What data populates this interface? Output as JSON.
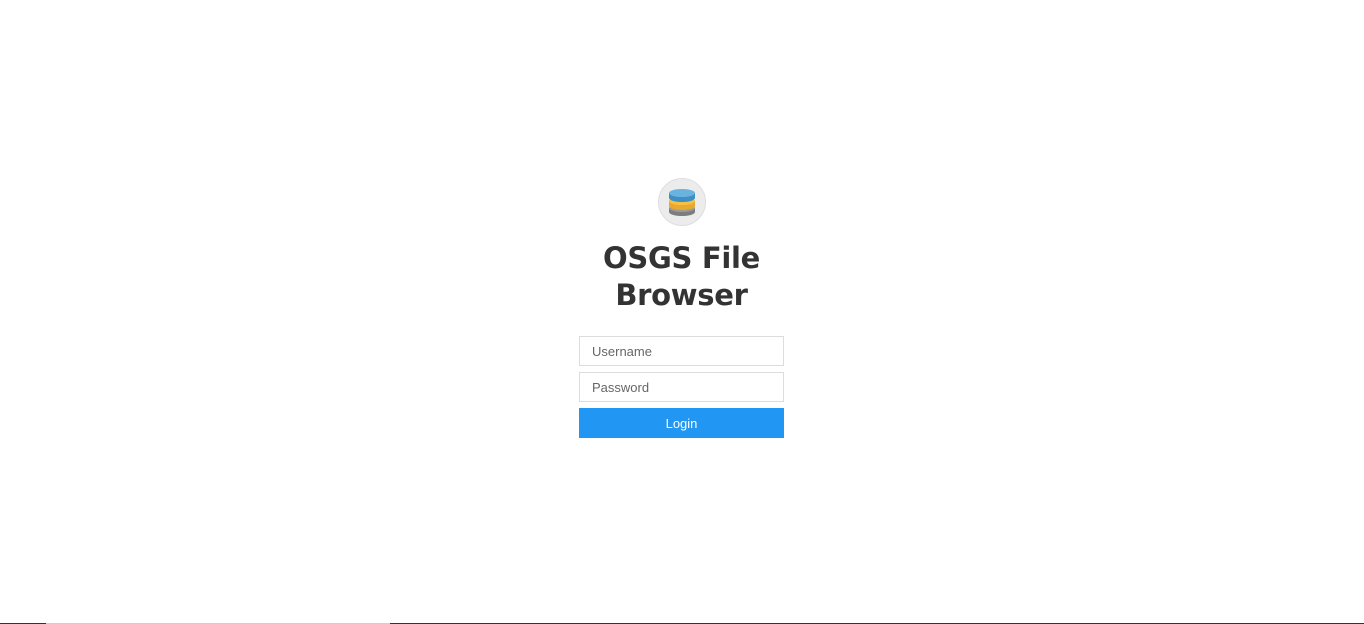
{
  "app": {
    "title_line1": "OSGS File",
    "title_line2": "Browser",
    "logo_icon": "database-stack-icon"
  },
  "login_form": {
    "username_placeholder": "Username",
    "username_value": "",
    "password_placeholder": "Password",
    "password_value": "",
    "login_label": "Login"
  },
  "colors": {
    "accent": "#2196f3",
    "title": "#333333",
    "logo_background": "#ececec"
  }
}
